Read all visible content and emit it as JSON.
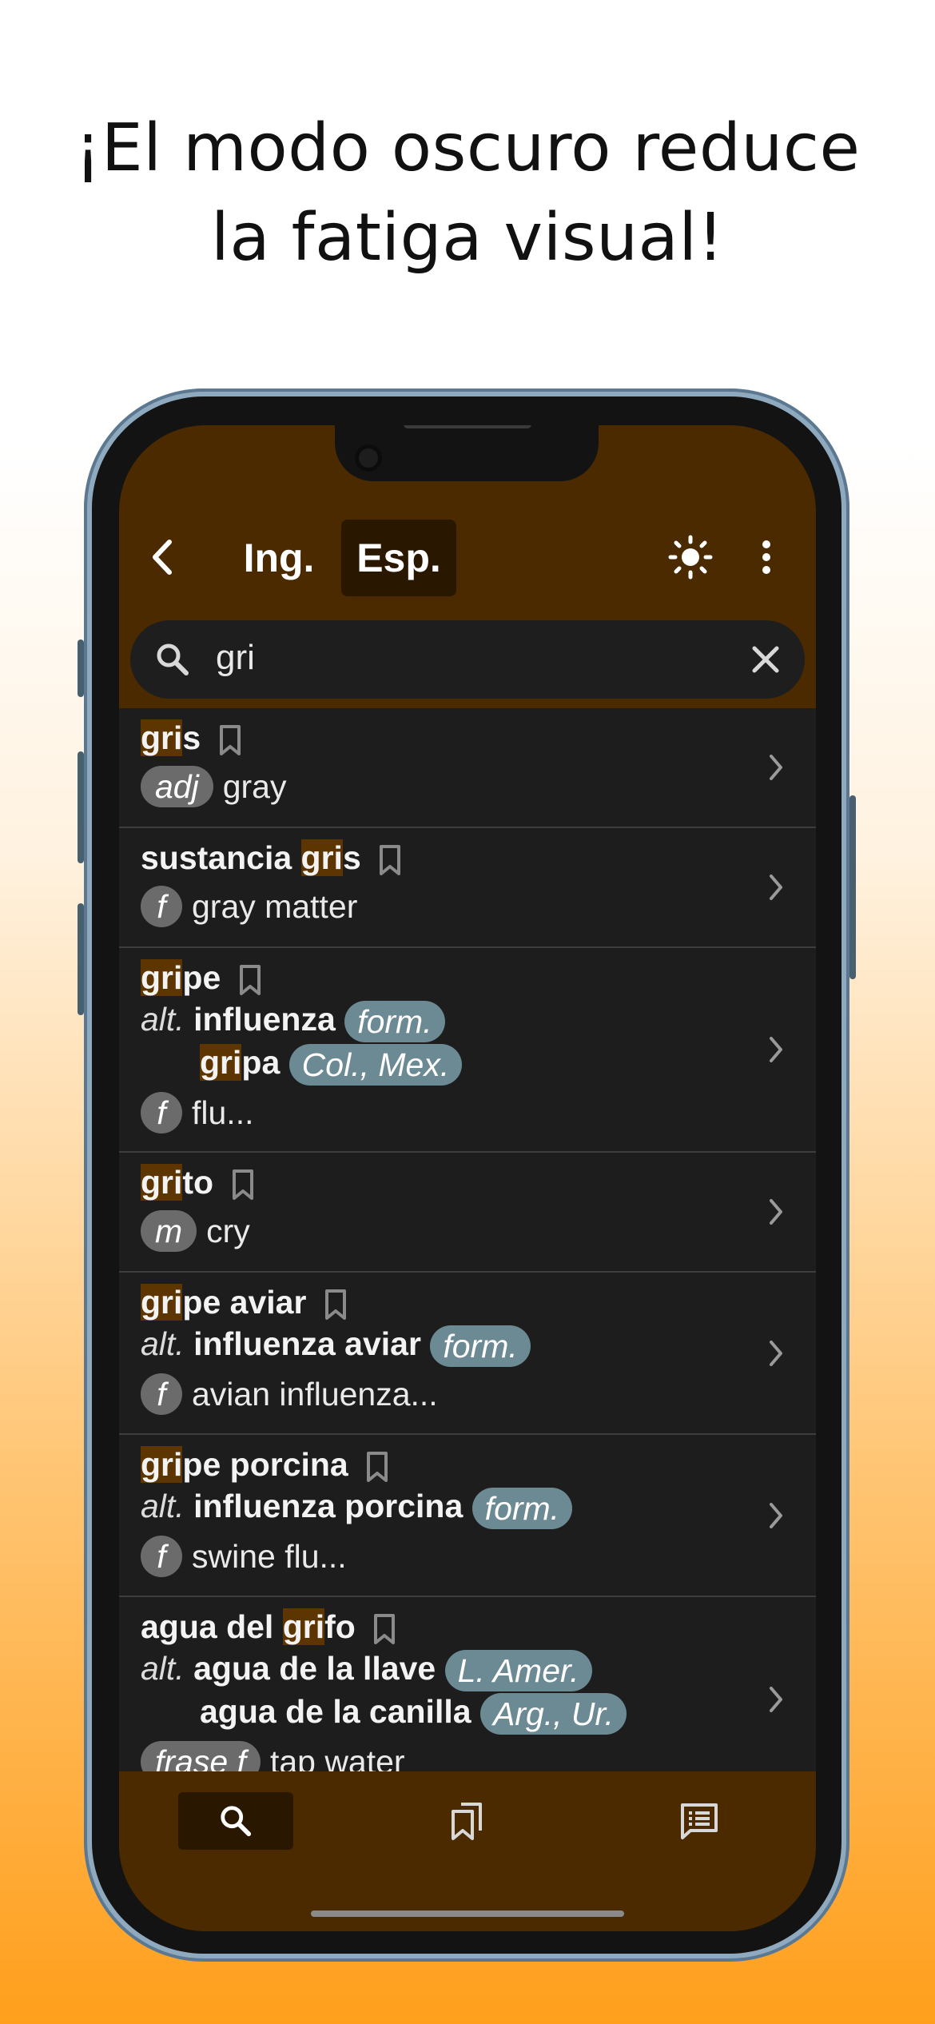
{
  "headline": {
    "line1": "¡El modo oscuro reduce",
    "line2": "la fatiga visual!"
  },
  "topbar": {
    "back_icon": "chevron-left-icon",
    "tab_english": "Ing.",
    "tab_spanish": "Esp.",
    "active_tab": "Esp.",
    "theme_icon": "sun-icon",
    "menu_icon": "more-vert-icon"
  },
  "search": {
    "value": "gri",
    "search_icon": "search-icon",
    "clear_icon": "close-icon"
  },
  "entries": [
    {
      "head_pre": "",
      "head_hl": "gri",
      "head_post": "s",
      "pos": "adj",
      "gloss": "gray"
    },
    {
      "head_pre": "sustancia ",
      "head_hl": "gri",
      "head_post": "s",
      "pos": "f",
      "gloss": "gray matter"
    },
    {
      "head_pre": "",
      "head_hl": "gri",
      "head_post": "pe",
      "alt_label": "alt.",
      "alt1_word": "influenza",
      "alt1_tag": "form.",
      "alt2_hl": "gri",
      "alt2_post": "pa",
      "alt2_tag": "Col., Mex.",
      "pos": "f",
      "gloss": "flu..."
    },
    {
      "head_pre": "",
      "head_hl": "gri",
      "head_post": "to",
      "pos": "m",
      "gloss": "cry"
    },
    {
      "head_pre": "",
      "head_hl": "gri",
      "head_post": "pe aviar",
      "alt_label": "alt.",
      "alt1_word": "influenza aviar",
      "alt1_tag": "form.",
      "pos": "f",
      "gloss": "avian influenza..."
    },
    {
      "head_pre": "",
      "head_hl": "gri",
      "head_post": "pe porcina",
      "alt_label": "alt.",
      "alt1_word": "influenza porcina",
      "alt1_tag": "form.",
      "pos": "f",
      "gloss": "swine flu..."
    },
    {
      "head_pre": "agua del ",
      "head_hl": "gri",
      "head_post": "fo",
      "alt_label": "alt.",
      "alt1_word": "agua de la llave",
      "alt1_tag": "L. Amer.",
      "alt2_word": "agua de la canilla",
      "alt2_tag": "Arg., Ur.",
      "pos": "frase f",
      "gloss": "tap water"
    }
  ],
  "bottomnav": {
    "search_icon": "search-icon",
    "bookmarks_icon": "bookmarks-icon",
    "notes_icon": "notes-icon",
    "active": "search"
  },
  "colors": {
    "accent_dark": "#4b2a00",
    "highlight": "#5d3500",
    "tag": "#6c8a94",
    "list_bg": "#1d1d1d"
  }
}
